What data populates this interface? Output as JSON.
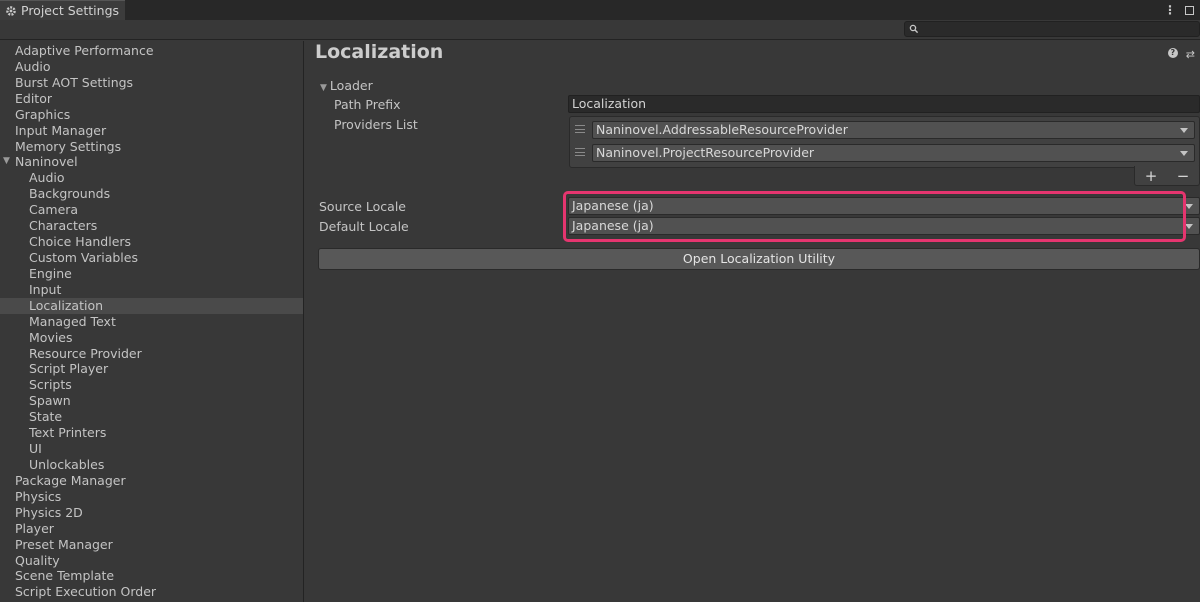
{
  "window": {
    "tab_title": "Project Settings",
    "menu_icon": "kebab-menu-icon",
    "maximize_icon": "maximize-icon"
  },
  "toolbar": {
    "search_placeholder": "",
    "search_icon": "search-icon"
  },
  "sidebar": {
    "items": [
      {
        "label": "Adaptive Performance",
        "level": 0
      },
      {
        "label": "Audio",
        "level": 0
      },
      {
        "label": "Burst AOT Settings",
        "level": 0
      },
      {
        "label": "Editor",
        "level": 0
      },
      {
        "label": "Graphics",
        "level": 0
      },
      {
        "label": "Input Manager",
        "level": 0
      },
      {
        "label": "Memory Settings",
        "level": 0
      },
      {
        "label": "Naninovel",
        "level": 0,
        "expanded": true
      },
      {
        "label": "Audio",
        "level": 1
      },
      {
        "label": "Backgrounds",
        "level": 1
      },
      {
        "label": "Camera",
        "level": 1
      },
      {
        "label": "Characters",
        "level": 1
      },
      {
        "label": "Choice Handlers",
        "level": 1
      },
      {
        "label": "Custom Variables",
        "level": 1
      },
      {
        "label": "Engine",
        "level": 1
      },
      {
        "label": "Input",
        "level": 1
      },
      {
        "label": "Localization",
        "level": 1,
        "selected": true
      },
      {
        "label": "Managed Text",
        "level": 1
      },
      {
        "label": "Movies",
        "level": 1
      },
      {
        "label": "Resource Provider",
        "level": 1
      },
      {
        "label": "Script Player",
        "level": 1
      },
      {
        "label": "Scripts",
        "level": 1
      },
      {
        "label": "Spawn",
        "level": 1
      },
      {
        "label": "State",
        "level": 1
      },
      {
        "label": "Text Printers",
        "level": 1
      },
      {
        "label": "UI",
        "level": 1
      },
      {
        "label": "Unlockables",
        "level": 1
      },
      {
        "label": "Package Manager",
        "level": 0
      },
      {
        "label": "Physics",
        "level": 0
      },
      {
        "label": "Physics 2D",
        "level": 0
      },
      {
        "label": "Player",
        "level": 0
      },
      {
        "label": "Preset Manager",
        "level": 0
      },
      {
        "label": "Quality",
        "level": 0
      },
      {
        "label": "Scene Template",
        "level": 0
      },
      {
        "label": "Script Execution Order",
        "level": 0
      }
    ]
  },
  "main": {
    "title": "Localization",
    "loader_label": "Loader",
    "path_prefix_label": "Path Prefix",
    "path_prefix_value": "Localization",
    "providers_label": "Providers List",
    "providers": [
      "Naninovel.AddressableResourceProvider",
      "Naninovel.ProjectResourceProvider"
    ],
    "add_symbol": "+",
    "remove_symbol": "−",
    "source_locale_label": "Source Locale",
    "source_locale_value": "Japanese (ja)",
    "default_locale_label": "Default Locale",
    "default_locale_value": "Japanese (ja)",
    "open_utility_label": "Open Localization Utility"
  },
  "colors": {
    "highlight": "#e5356f",
    "background": "#383838"
  }
}
